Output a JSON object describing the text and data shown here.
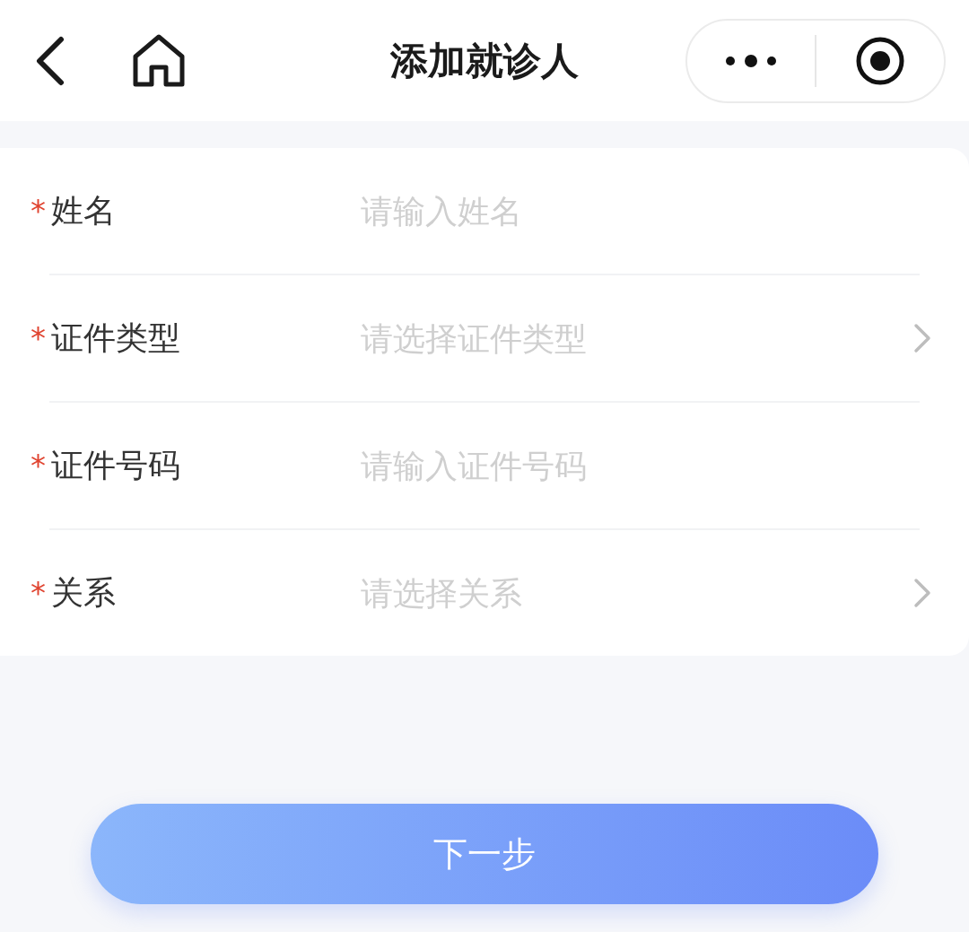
{
  "nav": {
    "title": "添加就诊人"
  },
  "form": {
    "rows": [
      {
        "kind": "input",
        "label": "姓名",
        "required_mark": "*",
        "placeholder": "请输入姓名"
      },
      {
        "kind": "select",
        "label": "证件类型",
        "required_mark": "*",
        "placeholder": "请选择证件类型"
      },
      {
        "kind": "input",
        "label": "证件号码",
        "required_mark": "*",
        "placeholder": "请输入证件号码"
      },
      {
        "kind": "select",
        "label": "关系",
        "required_mark": "*",
        "placeholder": "请选择关系"
      }
    ]
  },
  "next_button": {
    "label": "下一步"
  }
}
